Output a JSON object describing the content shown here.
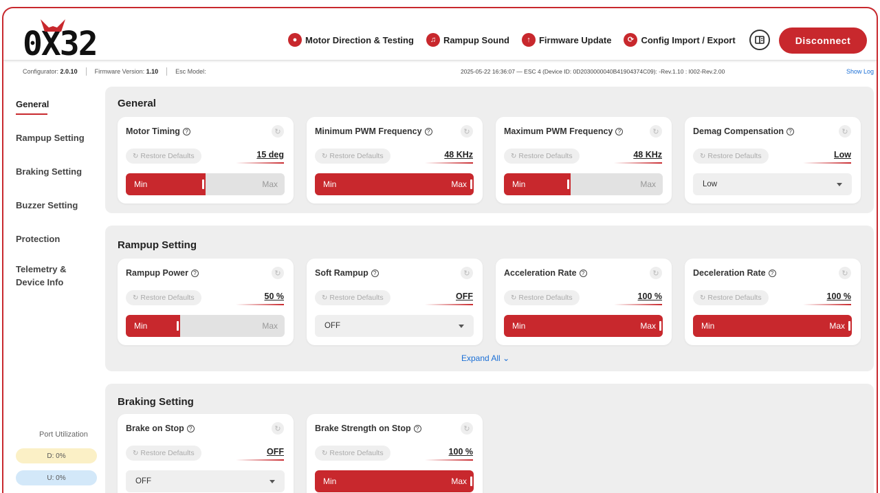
{
  "header": {
    "logo_text": "0X32",
    "nav": [
      {
        "label": "Motor Direction & Testing",
        "icon": "motor-icon"
      },
      {
        "label": "Rampup Sound",
        "icon": "music-note-icon"
      },
      {
        "label": "Firmware Update",
        "icon": "arrow-up-icon"
      },
      {
        "label": "Config Import / Export",
        "icon": "sync-icon"
      }
    ],
    "book_icon": "book-icon",
    "disconnect_label": "Disconnect"
  },
  "status": {
    "configurator_label": "Configurator:",
    "configurator_version": "2.0.10",
    "firmware_label": "Firmware Version:",
    "firmware_version": "1.10",
    "esc_model_label": "Esc Model:",
    "device_info": "2025-05-22 16:36:07 — ESC 4 (Device ID: 0D2030000040B41904374C09): -Rev.1.10 : I002-Rev.2.00",
    "show_log": "Show Log"
  },
  "sidebar": {
    "items": [
      "General",
      "Rampup Setting",
      "Braking Setting",
      "Buzzer Setting",
      "Protection",
      "Telemetry &",
      "Device Info"
    ],
    "port_title": "Port Utilization",
    "port_d": "D: 0%",
    "port_u": "U: 0%"
  },
  "common": {
    "restore": "Restore Defaults",
    "min": "Min",
    "max": "Max",
    "help": "?"
  },
  "sections": {
    "general": {
      "title": "General",
      "cards": [
        {
          "label": "Motor Timing",
          "value": "15 deg",
          "fill": 0.5
        },
        {
          "label": "Minimum PWM Frequency",
          "value": "48 KHz",
          "fill": 1.0
        },
        {
          "label": "Maximum PWM Frequency",
          "value": "48 KHz",
          "fill": 0.42
        },
        {
          "label": "Demag Compensation",
          "value": "Low",
          "option": "Low"
        }
      ]
    },
    "rampup": {
      "title": "Rampup Setting",
      "cards": [
        {
          "label": "Rampup Power",
          "value": "50 %",
          "fill": 0.34
        },
        {
          "label": "Soft Rampup",
          "value": "OFF",
          "option": "OFF"
        },
        {
          "label": "Acceleration Rate",
          "value": "100 %",
          "fill": 1.0
        },
        {
          "label": "Deceleration Rate",
          "value": "100 %",
          "fill": 1.0
        }
      ],
      "expand": "Expand All"
    },
    "braking": {
      "title": "Braking Setting",
      "cards": [
        {
          "label": "Brake on Stop",
          "value": "OFF",
          "option": "OFF"
        },
        {
          "label": "Brake Strength on Stop",
          "value": "100 %",
          "fill": 1.0
        }
      ]
    }
  },
  "colors": {
    "accent": "#c8282d",
    "link": "#1a6fd6",
    "section_bg": "#eeeeee"
  }
}
